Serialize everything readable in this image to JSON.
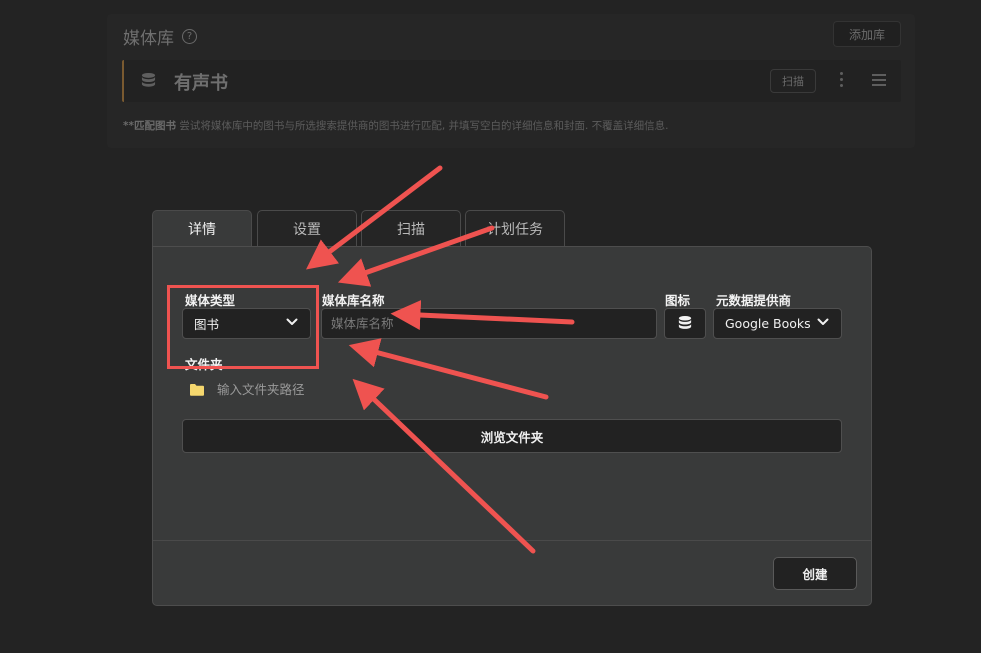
{
  "background": {
    "title": "媒体库",
    "add_button": "添加库",
    "library_name": "有声书",
    "scan_button": "扫描",
    "note_bold": "**匹配图书",
    "note_text": " 尝试将媒体库中的图书与所选搜索提供商的图书进行匹配, 并填写空白的详细信息和封面. 不覆盖详细信息."
  },
  "tabs": [
    {
      "label": "详情",
      "active": true
    },
    {
      "label": "设置",
      "active": false
    },
    {
      "label": "扫描",
      "active": false
    },
    {
      "label": "计划任务",
      "active": false
    }
  ],
  "form": {
    "media_type_label": "媒体类型",
    "media_type_value": "图书",
    "library_name_label": "媒体库名称",
    "library_name_placeholder": "媒体库名称",
    "icon_label": "图标",
    "provider_label": "元数据提供商",
    "provider_value": "Google Books",
    "folder_label": "文件夹",
    "folder_placeholder": "输入文件夹路径",
    "browse_button": "浏览文件夹",
    "create_button": "创建"
  },
  "colors": {
    "annotation": "#ef5350",
    "folder_icon": "#f5d76e",
    "background": "#232323",
    "modal": "#393a3a"
  },
  "icons": [
    "help-icon",
    "database-icon",
    "more-vertical-icon",
    "drag-handle-icon",
    "chevron-down-icon",
    "folder-icon"
  ]
}
